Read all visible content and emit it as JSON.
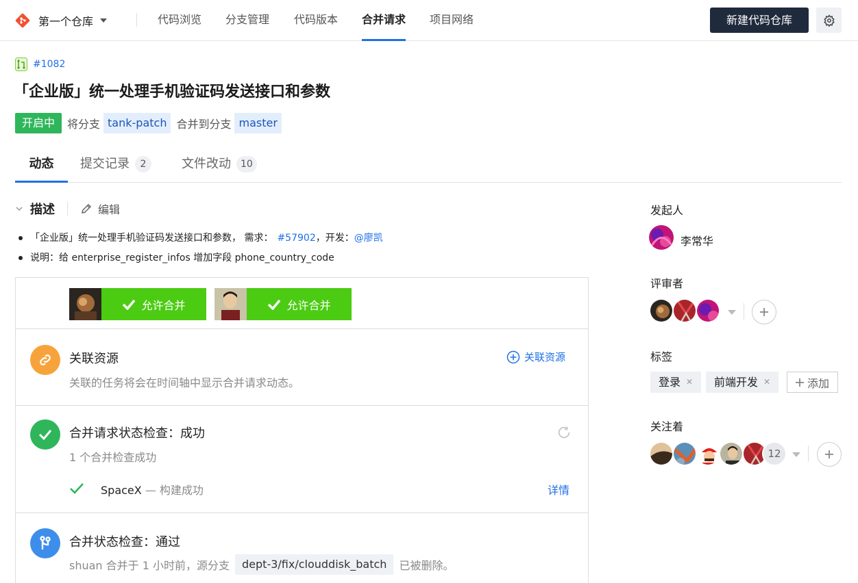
{
  "repo": {
    "name": "第一个仓库"
  },
  "nav": {
    "tabs": [
      {
        "label": "代码浏览"
      },
      {
        "label": "分支管理"
      },
      {
        "label": "代码版本"
      },
      {
        "label": "合并请求"
      },
      {
        "label": "项目网络"
      }
    ],
    "active_tab": "合并请求",
    "new_repo_label": "新建代码仓库"
  },
  "mr": {
    "id": "#1082",
    "title": "「企业版」统一处理手机验证码发送接口和参数",
    "status": "开启中",
    "from_text": "将分支",
    "source_branch": "tank-patch",
    "to_text": "合并到分支",
    "target_branch": "master"
  },
  "tabs": [
    {
      "label": "动态",
      "count": ""
    },
    {
      "label": "提交记录",
      "count": "2"
    },
    {
      "label": "文件改动",
      "count": "10"
    }
  ],
  "description": {
    "title": "描述",
    "edit_label": "编辑",
    "line1_prefix": "「企业版」统一处理手机验证码发送接口和参数， 需求：",
    "line1_issue": "#57902",
    "line1_mid": "，开发：",
    "line1_dev": "@廖凯",
    "line2": "说明：给 enterprise_register_infos 增加字段 phone_country_code"
  },
  "approvals": [
    {
      "label": "允许合并"
    },
    {
      "label": "允许合并"
    }
  ],
  "resources": {
    "title": "关联资源",
    "subtitle": "关联的任务将会在时间轴中显示合并请求动态。",
    "action": "关联资源"
  },
  "check": {
    "title": "合并请求状态检查：成功",
    "subtitle": "1 个合并检查成功",
    "item_name": "SpaceX",
    "item_status": "— 构建成功",
    "detail": "详情"
  },
  "merge_status": {
    "title": "合并状态检查：通过",
    "text_before": "shuan 合并于 1 小时前，源分支",
    "branch": "dept-3/fix/clouddisk_batch",
    "text_after": "已被删除。"
  },
  "sidebar": {
    "author_label": "发起人",
    "author_name": "李常华",
    "reviewers_label": "评审者",
    "labels_label": "标签",
    "labels": [
      "登录",
      "前端开发"
    ],
    "add_label": "添加",
    "watchers_label": "关注着",
    "watchers_more": "12"
  },
  "colors": {
    "primary": "#1f6fe6",
    "success": "#2fb65b",
    "approve": "#4ccb13",
    "dark_button": "#1f2a3c",
    "link_icon_bg": "#f7a33c",
    "check_icon_bg": "#2fb65b",
    "merge_icon_bg": "#3d8eea"
  }
}
